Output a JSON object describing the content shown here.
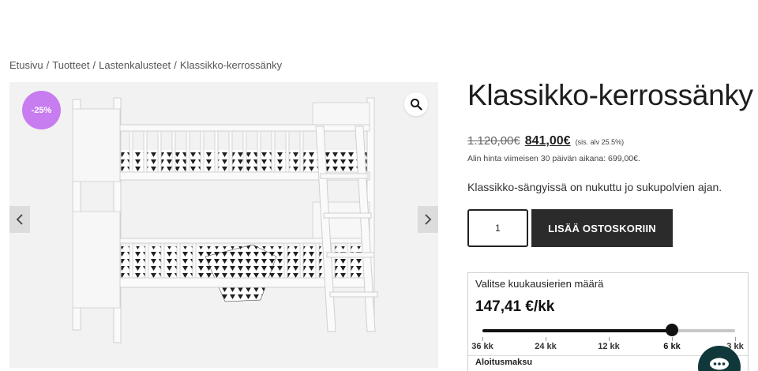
{
  "breadcrumb": {
    "items": [
      "Etusivu",
      "Tuotteet",
      "Lastenkalusteet",
      "Klassikko-kerrossänky"
    ],
    "separator": "/"
  },
  "gallery": {
    "badge": "-25%",
    "badge_color": "#c77df0",
    "icons": {
      "zoom": "search-icon",
      "prev": "chevron-left-icon",
      "next": "chevron-right-icon"
    },
    "image": "bunk-bed-image"
  },
  "product": {
    "title": "Klassikko-kerrossänky",
    "old_price": "1.120,00€",
    "price": "841,00€",
    "vat_note": "(sis. alv 25.5%)",
    "lowest_price_note": "Alin hinta viimeisen 30 päivän aikana: 699,00€.",
    "description": "Klassikko-sängyissä on nukuttu jo sukupolvien ajan.",
    "quantity": "1",
    "add_to_cart": "LISÄÄ OSTOSKORIIN"
  },
  "financing": {
    "title": "Valitse kuukausierien määrä",
    "monthly_amount": "147,41 €/kk",
    "options": [
      "36 kk",
      "24 kk",
      "12 kk",
      "6 kk",
      "3 kk"
    ],
    "selected": "6 kk",
    "initial_fee_label": "Aloitusmaksu"
  },
  "chat": {
    "icon": "chat-icon",
    "color": "#10383a"
  }
}
